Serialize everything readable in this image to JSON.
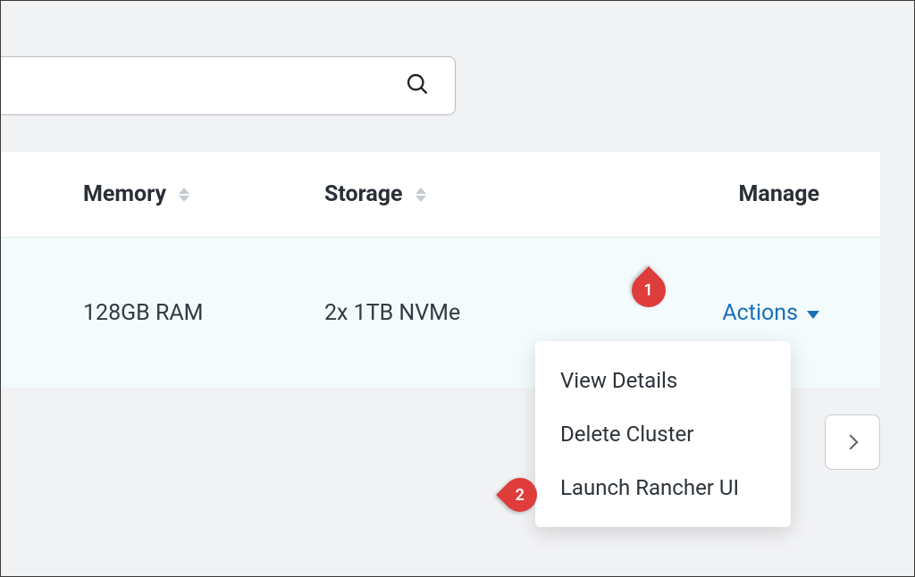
{
  "search": {
    "placeholder": ""
  },
  "table": {
    "columns": {
      "memory": "Memory",
      "storage": "Storage",
      "manage": "Manage"
    },
    "row": {
      "memory": "128GB RAM",
      "storage": "2x 1TB NVMe",
      "actions_label": "Actions"
    }
  },
  "dropdown": {
    "items": [
      {
        "label": "View Details"
      },
      {
        "label": "Delete Cluster"
      },
      {
        "label": "Launch Rancher UI"
      }
    ]
  },
  "annotations": {
    "1": "1",
    "2": "2"
  }
}
